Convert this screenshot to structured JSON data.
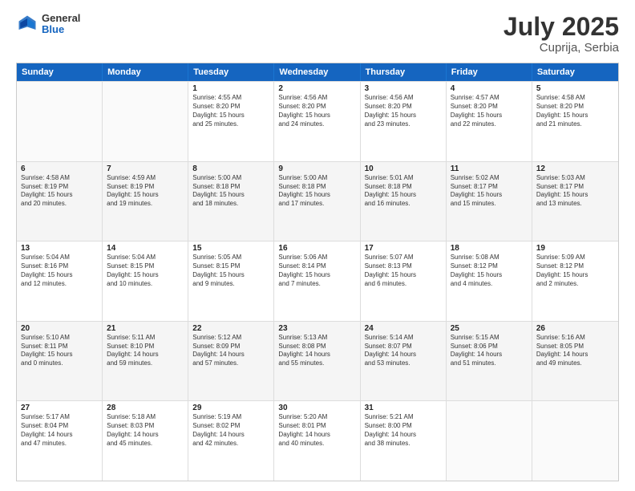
{
  "header": {
    "logo_general": "General",
    "logo_blue": "Blue",
    "month_year": "July 2025",
    "location": "Cuprija, Serbia"
  },
  "weekdays": [
    "Sunday",
    "Monday",
    "Tuesday",
    "Wednesday",
    "Thursday",
    "Friday",
    "Saturday"
  ],
  "rows": [
    [
      {
        "day": "",
        "empty": true
      },
      {
        "day": "",
        "empty": true
      },
      {
        "day": "1",
        "lines": [
          "Sunrise: 4:55 AM",
          "Sunset: 8:20 PM",
          "Daylight: 15 hours",
          "and 25 minutes."
        ]
      },
      {
        "day": "2",
        "lines": [
          "Sunrise: 4:56 AM",
          "Sunset: 8:20 PM",
          "Daylight: 15 hours",
          "and 24 minutes."
        ]
      },
      {
        "day": "3",
        "lines": [
          "Sunrise: 4:56 AM",
          "Sunset: 8:20 PM",
          "Daylight: 15 hours",
          "and 23 minutes."
        ]
      },
      {
        "day": "4",
        "lines": [
          "Sunrise: 4:57 AM",
          "Sunset: 8:20 PM",
          "Daylight: 15 hours",
          "and 22 minutes."
        ]
      },
      {
        "day": "5",
        "lines": [
          "Sunrise: 4:58 AM",
          "Sunset: 8:20 PM",
          "Daylight: 15 hours",
          "and 21 minutes."
        ]
      }
    ],
    [
      {
        "day": "6",
        "lines": [
          "Sunrise: 4:58 AM",
          "Sunset: 8:19 PM",
          "Daylight: 15 hours",
          "and 20 minutes."
        ]
      },
      {
        "day": "7",
        "lines": [
          "Sunrise: 4:59 AM",
          "Sunset: 8:19 PM",
          "Daylight: 15 hours",
          "and 19 minutes."
        ]
      },
      {
        "day": "8",
        "lines": [
          "Sunrise: 5:00 AM",
          "Sunset: 8:18 PM",
          "Daylight: 15 hours",
          "and 18 minutes."
        ]
      },
      {
        "day": "9",
        "lines": [
          "Sunrise: 5:00 AM",
          "Sunset: 8:18 PM",
          "Daylight: 15 hours",
          "and 17 minutes."
        ]
      },
      {
        "day": "10",
        "lines": [
          "Sunrise: 5:01 AM",
          "Sunset: 8:18 PM",
          "Daylight: 15 hours",
          "and 16 minutes."
        ]
      },
      {
        "day": "11",
        "lines": [
          "Sunrise: 5:02 AM",
          "Sunset: 8:17 PM",
          "Daylight: 15 hours",
          "and 15 minutes."
        ]
      },
      {
        "day": "12",
        "lines": [
          "Sunrise: 5:03 AM",
          "Sunset: 8:17 PM",
          "Daylight: 15 hours",
          "and 13 minutes."
        ]
      }
    ],
    [
      {
        "day": "13",
        "lines": [
          "Sunrise: 5:04 AM",
          "Sunset: 8:16 PM",
          "Daylight: 15 hours",
          "and 12 minutes."
        ]
      },
      {
        "day": "14",
        "lines": [
          "Sunrise: 5:04 AM",
          "Sunset: 8:15 PM",
          "Daylight: 15 hours",
          "and 10 minutes."
        ]
      },
      {
        "day": "15",
        "lines": [
          "Sunrise: 5:05 AM",
          "Sunset: 8:15 PM",
          "Daylight: 15 hours",
          "and 9 minutes."
        ]
      },
      {
        "day": "16",
        "lines": [
          "Sunrise: 5:06 AM",
          "Sunset: 8:14 PM",
          "Daylight: 15 hours",
          "and 7 minutes."
        ]
      },
      {
        "day": "17",
        "lines": [
          "Sunrise: 5:07 AM",
          "Sunset: 8:13 PM",
          "Daylight: 15 hours",
          "and 6 minutes."
        ]
      },
      {
        "day": "18",
        "lines": [
          "Sunrise: 5:08 AM",
          "Sunset: 8:12 PM",
          "Daylight: 15 hours",
          "and 4 minutes."
        ]
      },
      {
        "day": "19",
        "lines": [
          "Sunrise: 5:09 AM",
          "Sunset: 8:12 PM",
          "Daylight: 15 hours",
          "and 2 minutes."
        ]
      }
    ],
    [
      {
        "day": "20",
        "lines": [
          "Sunrise: 5:10 AM",
          "Sunset: 8:11 PM",
          "Daylight: 15 hours",
          "and 0 minutes."
        ]
      },
      {
        "day": "21",
        "lines": [
          "Sunrise: 5:11 AM",
          "Sunset: 8:10 PM",
          "Daylight: 14 hours",
          "and 59 minutes."
        ]
      },
      {
        "day": "22",
        "lines": [
          "Sunrise: 5:12 AM",
          "Sunset: 8:09 PM",
          "Daylight: 14 hours",
          "and 57 minutes."
        ]
      },
      {
        "day": "23",
        "lines": [
          "Sunrise: 5:13 AM",
          "Sunset: 8:08 PM",
          "Daylight: 14 hours",
          "and 55 minutes."
        ]
      },
      {
        "day": "24",
        "lines": [
          "Sunrise: 5:14 AM",
          "Sunset: 8:07 PM",
          "Daylight: 14 hours",
          "and 53 minutes."
        ]
      },
      {
        "day": "25",
        "lines": [
          "Sunrise: 5:15 AM",
          "Sunset: 8:06 PM",
          "Daylight: 14 hours",
          "and 51 minutes."
        ]
      },
      {
        "day": "26",
        "lines": [
          "Sunrise: 5:16 AM",
          "Sunset: 8:05 PM",
          "Daylight: 14 hours",
          "and 49 minutes."
        ]
      }
    ],
    [
      {
        "day": "27",
        "lines": [
          "Sunrise: 5:17 AM",
          "Sunset: 8:04 PM",
          "Daylight: 14 hours",
          "and 47 minutes."
        ]
      },
      {
        "day": "28",
        "lines": [
          "Sunrise: 5:18 AM",
          "Sunset: 8:03 PM",
          "Daylight: 14 hours",
          "and 45 minutes."
        ]
      },
      {
        "day": "29",
        "lines": [
          "Sunrise: 5:19 AM",
          "Sunset: 8:02 PM",
          "Daylight: 14 hours",
          "and 42 minutes."
        ]
      },
      {
        "day": "30",
        "lines": [
          "Sunrise: 5:20 AM",
          "Sunset: 8:01 PM",
          "Daylight: 14 hours",
          "and 40 minutes."
        ]
      },
      {
        "day": "31",
        "lines": [
          "Sunrise: 5:21 AM",
          "Sunset: 8:00 PM",
          "Daylight: 14 hours",
          "and 38 minutes."
        ]
      },
      {
        "day": "",
        "empty": true
      },
      {
        "day": "",
        "empty": true
      }
    ]
  ]
}
